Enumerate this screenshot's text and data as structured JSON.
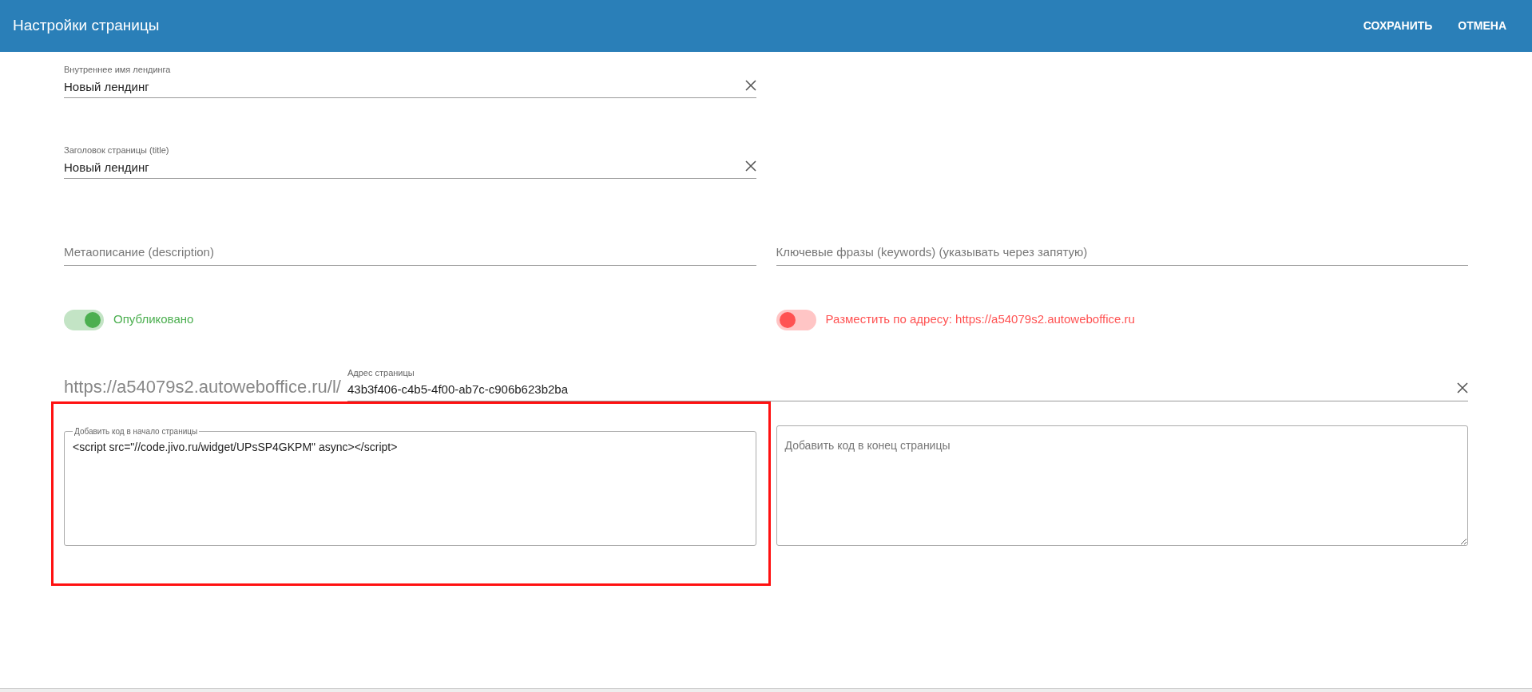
{
  "header": {
    "title": "Настройки страницы",
    "actions": [
      "СОХРАНИТЬ",
      "ОТМЕНА"
    ]
  },
  "name_fields": [
    {
      "label": "Внутреннее имя лендинга",
      "value": "Новый лендинг"
    },
    {
      "label": "Заголовок страницы (title)",
      "value": "Новый лендинг"
    }
  ],
  "meta_fields": [
    {
      "placeholder": "Метаописание (description)"
    },
    {
      "placeholder": "Ключевые фразы (keywords) (указывать через запятую)"
    }
  ],
  "toggles": [
    {
      "label": "Опубликовано",
      "on": true,
      "color": "#4caf50"
    },
    {
      "label": "Разместить по адресу: https://a54079s2.autoweboffice.ru",
      "on": false,
      "color": "#ff5252"
    }
  ],
  "address": {
    "prefix": "https://a54079s2.autoweboffice.ru/l/",
    "label": "Адрес страницы",
    "value": "43b3f406-c4b5-4f00-ab7c-c906b623b2ba"
  },
  "code_fields": [
    {
      "label": "Добавить код в начало страницы",
      "value": "<script src=\"//code.jivo.ru/widget/UPsSP4GKPM\" async></script>",
      "highlighted": true
    },
    {
      "placeholder": "Добавить код в конец страницы",
      "highlighted": false
    }
  ]
}
